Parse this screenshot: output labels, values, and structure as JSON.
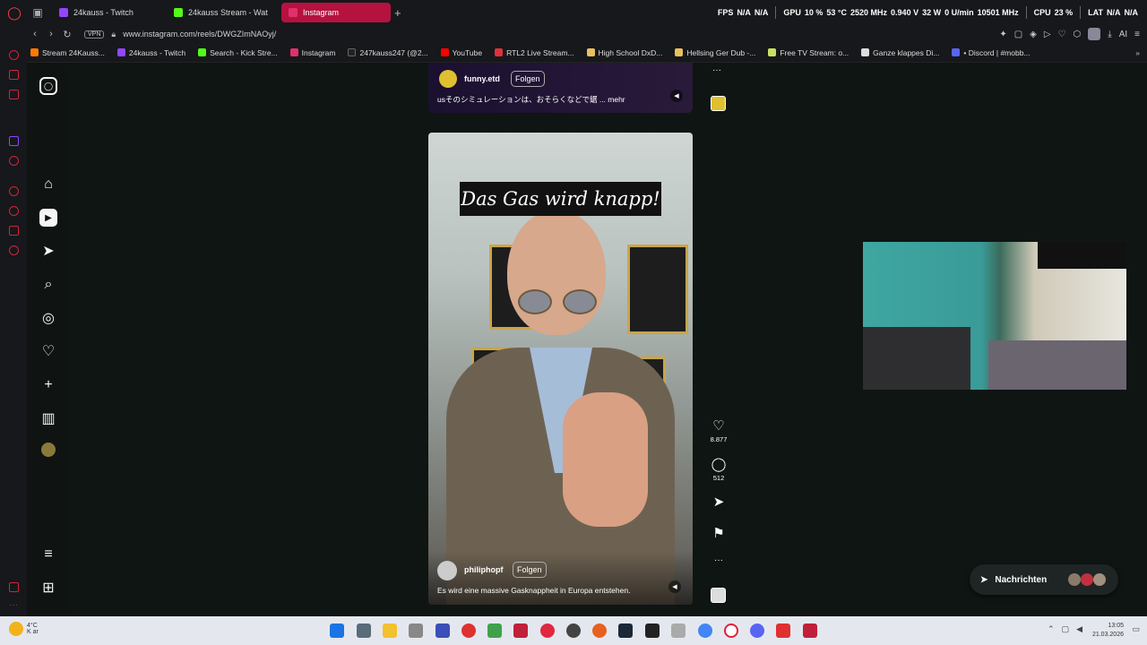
{
  "tabs": [
    {
      "label": "24kauss - Twitch",
      "fav_color": "#9146ff"
    },
    {
      "label": "24kauss Stream - Wat",
      "fav_color": "#53fc18"
    },
    {
      "label": "Instagram",
      "fav_color": "#e1306c",
      "active": true
    }
  ],
  "hardware": {
    "fps_label": "FPS",
    "fps_val1": "N/A",
    "fps_val2": "N/A",
    "gpu_label": "GPU",
    "gpu_usage": "10 %",
    "gpu_temp": "53 °C",
    "gpu_clock": "2520 MHz",
    "gpu_volt": "0.940 V",
    "gpu_power": "32 W",
    "gpu_fan": "0 U/min",
    "gpu_mem": "10501 MHz",
    "cpu_label": "CPU",
    "cpu_usage": "23 %",
    "lat_label": "LAT",
    "lat_val1": "N/A",
    "lat_val2": "N/A"
  },
  "address": {
    "vpn": "VPN",
    "url": "www.instagram.com/reels/DWGZImNAOyj/",
    "ai": "AI"
  },
  "bookmarks": [
    {
      "label": "Stream 24Kauss...",
      "fav_color": "#ff7a00"
    },
    {
      "label": "24kauss - Twitch",
      "fav_color": "#9146ff"
    },
    {
      "label": "Search - Kick Stre...",
      "fav_color": "#53fc18"
    },
    {
      "label": "Instagram",
      "fav_color": "#e1306c"
    },
    {
      "label": "247kauss247 (@2...",
      "fav_color": "#222222"
    },
    {
      "label": "YouTube",
      "fav_color": "#ff0000"
    },
    {
      "label": "RTL2 Live Stream...",
      "fav_color": "#e0303a"
    },
    {
      "label": "High School DxD...",
      "fav_color": "#e8c060"
    },
    {
      "label": "Hellsing Ger Dub -...",
      "fav_color": "#e8c060"
    },
    {
      "label": "Free TV Stream: o...",
      "fav_color": "#c8e060"
    },
    {
      "label": "Ganze klappes Di...",
      "fav_color": "#dddddd"
    },
    {
      "label": "• Discord | #mobb...",
      "fav_color": "#5865f2"
    }
  ],
  "prev_reel": {
    "username": "funny.etd",
    "follow": "Folgen",
    "caption": "usそのシミュレーションは、おそらくなどで鋸 ... mehr"
  },
  "reel": {
    "overlay_text": "Das Gas wird knapp!",
    "username": "philiphopf",
    "follow": "Folgen",
    "caption": "Es wird eine massive Gasknappheit in Europa entstehen.",
    "likes": "8.877",
    "comments": "512"
  },
  "icons": {
    "like": "heart-icon",
    "comment": "comment-icon",
    "share": "send-icon",
    "save": "bookmark-icon",
    "more": "more-icon"
  },
  "messages": {
    "label": "Nachrichten"
  },
  "taskbar": {
    "temp": "4°C",
    "weather_text": "K ar",
    "time": "13:05",
    "date": "21.03.2026"
  },
  "colors": {
    "accent": "#b5123f",
    "opera_red": "#d2233d"
  }
}
